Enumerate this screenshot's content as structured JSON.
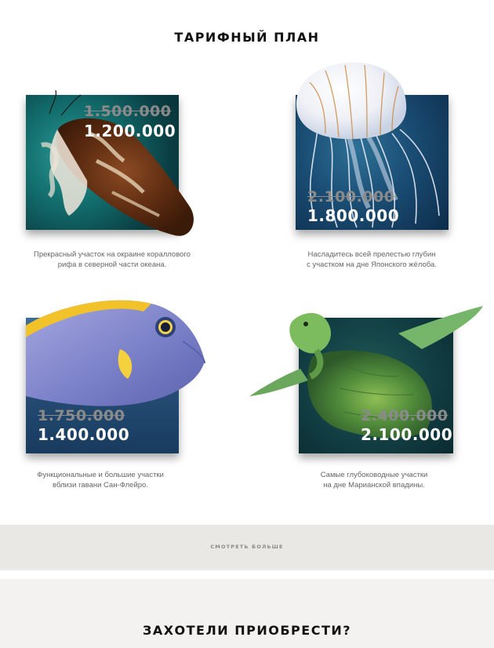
{
  "header": {
    "title": "ТАРИФНЫЙ ПЛАН"
  },
  "plans": [
    {
      "price_old": "1.500.000",
      "price_new": "1.200.000",
      "desc_line1": "Прекрасный участок на окраине кораллового",
      "desc_line2": "рифа в северной части океана."
    },
    {
      "price_old": "2.100.000",
      "price_new": "1.800.000",
      "desc_line1": "Насладитесь всей прелестью глубин",
      "desc_line2": "с участком на дне Японского жёлоба."
    },
    {
      "price_old": "1.750.000",
      "price_new": "1.400.000",
      "desc_line1": "Функциональные и большие участки",
      "desc_line2": "вблизи гавани Сан-Флейро."
    },
    {
      "price_old": "2.400.000",
      "price_new": "2.100.000",
      "desc_line1": "Самые глубоководные участки",
      "desc_line2": "на дне Марианской впадины."
    }
  ],
  "more": {
    "label": "СМОТРЕТЬ БОЛЬШЕ"
  },
  "footer": {
    "title": "ЗАХОТЕЛИ ПРИОБРЕСТИ?"
  },
  "colors": {
    "band_gray": "#e9e8e4",
    "band_light": "#f3f2f0",
    "price_old": "#8a8a8a",
    "price_new": "#ffffff"
  }
}
